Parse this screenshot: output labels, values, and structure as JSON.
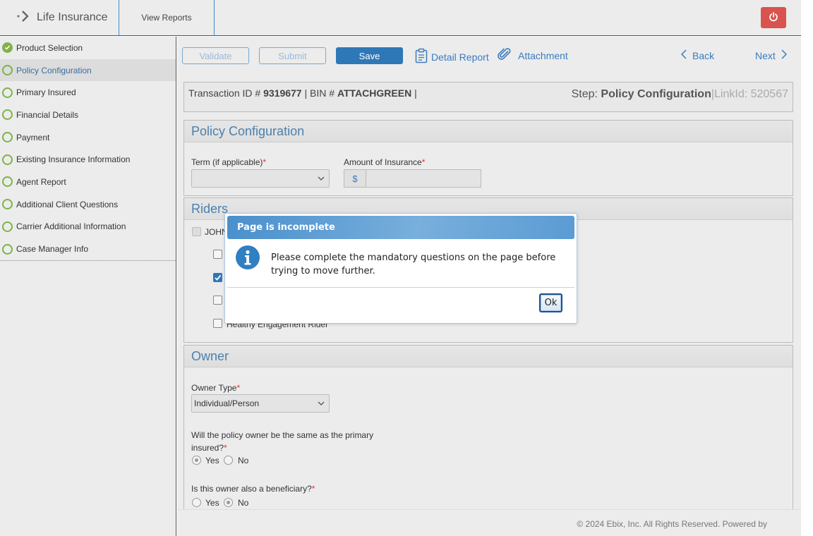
{
  "header": {
    "app_title": "Life Insurance",
    "nav_reports": "View Reports"
  },
  "sidebar": {
    "items": [
      {
        "label": "Product Selection",
        "status": "complete"
      },
      {
        "label": "Policy Configuration",
        "status": "active"
      },
      {
        "label": "Primary Insured",
        "status": "incomplete"
      },
      {
        "label": "Financial Details",
        "status": "incomplete"
      },
      {
        "label": "Payment",
        "status": "incomplete"
      },
      {
        "label": "Existing Insurance Information",
        "status": "incomplete"
      },
      {
        "label": "Agent Report",
        "status": "incomplete"
      },
      {
        "label": "Additional Client Questions",
        "status": "incomplete"
      },
      {
        "label": "Carrier Additional Information",
        "status": "incomplete"
      },
      {
        "label": "Case Manager Info",
        "status": "incomplete"
      }
    ]
  },
  "toolbar": {
    "validate": "Validate",
    "submit": "Submit",
    "save": "Save",
    "detail_report": "Detail Report",
    "attachment": "Attachment",
    "back": "Back",
    "next": "Next"
  },
  "transaction": {
    "id_label": "Transaction ID #",
    "id_value": "9319677",
    "bin_label": "| BIN #",
    "bin_value": "ATTACHGREEN",
    "bin_suffix": "|",
    "step_label": "Step:",
    "step_value": "Policy Configuration",
    "linkid_label": "|LinkId: 520567"
  },
  "policy_configuration": {
    "title": "Policy Configuration",
    "term_label": "Term (if applicable)",
    "term_value": "",
    "amount_label": "Amount of Insurance",
    "currency_symbol": "$",
    "amount_value": ""
  },
  "riders": {
    "title": "Riders",
    "insured_label": "JOHN",
    "visible_rider_label": "Healthy Engagement Rider",
    "checkbox_states": [
      false,
      true,
      false,
      false
    ]
  },
  "owner": {
    "title": "Owner",
    "owner_type_label": "Owner Type",
    "owner_type_value": "Individual/Person",
    "same_as_insured_q_line1": "Will the policy owner be the same as the primary",
    "same_as_insured_q_line2": "insured?",
    "same_as_insured_answer": "Yes",
    "beneficiary_q": "Is this owner also a beneficiary?",
    "beneficiary_answer": "No",
    "yes_label": "Yes",
    "no_label": "No",
    "required_mark": "*"
  },
  "footer": {
    "copyright": "© 2024 Ebix, Inc. All Rights Reserved. Powered by"
  },
  "modal": {
    "title": "Page is incomplete",
    "message": "Please complete the mandatory questions on the page before trying to move further.",
    "ok_label": "Ok"
  },
  "colors": {
    "accent": "#2f78b7",
    "complete_green": "#7fb24a",
    "power_red": "#d9534f",
    "required_red": "#dd3333"
  },
  "icons": {
    "logo": "chevron-right-dots-icon",
    "power": "power-icon",
    "detail_report": "clipboard-icon",
    "attachment": "paperclip-icon",
    "back": "chevron-left-icon",
    "next": "chevron-right-icon",
    "modal_info": "info-icon"
  }
}
